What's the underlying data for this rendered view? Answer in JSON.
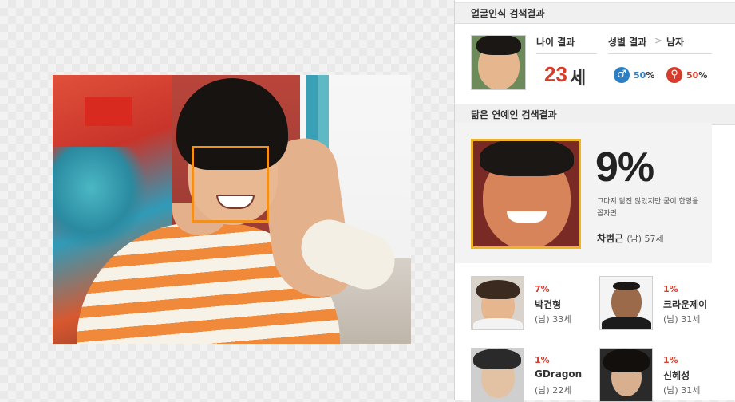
{
  "face_result": {
    "title": "얼굴인식 검색결과",
    "age_label": "나이 결과",
    "age_value": "23",
    "age_unit": "세",
    "gender_label": "성별 결과",
    "gender_sep": ">",
    "gender_value": "남자",
    "male_percent": "50",
    "female_percent": "50",
    "percent_unit": "%"
  },
  "similar": {
    "title": "닮은 연예인 검색결과",
    "best": {
      "percent": "9%",
      "description": "그다지 닮진 않았지만 굳이 한명을 꼽자면.",
      "name": "차범근",
      "meta": "(남) 57세"
    },
    "others": [
      {
        "percent": "7%",
        "name": "박건형",
        "meta": "(남) 33세"
      },
      {
        "percent": "1%",
        "name": "크라운제이",
        "meta": "(남) 31세"
      },
      {
        "percent": "1%",
        "name": "GDragon",
        "meta": "(남) 22세"
      },
      {
        "percent": "1%",
        "name": "신혜성",
        "meta": "(남) 31세"
      }
    ]
  },
  "colors": {
    "face_box": "#f2901e",
    "best_frame": "#f0b323",
    "accent_red": "#d73b2b",
    "accent_blue": "#2b7fc4"
  },
  "icons": {
    "male": "male-symbol-icon",
    "female": "female-symbol-icon"
  }
}
